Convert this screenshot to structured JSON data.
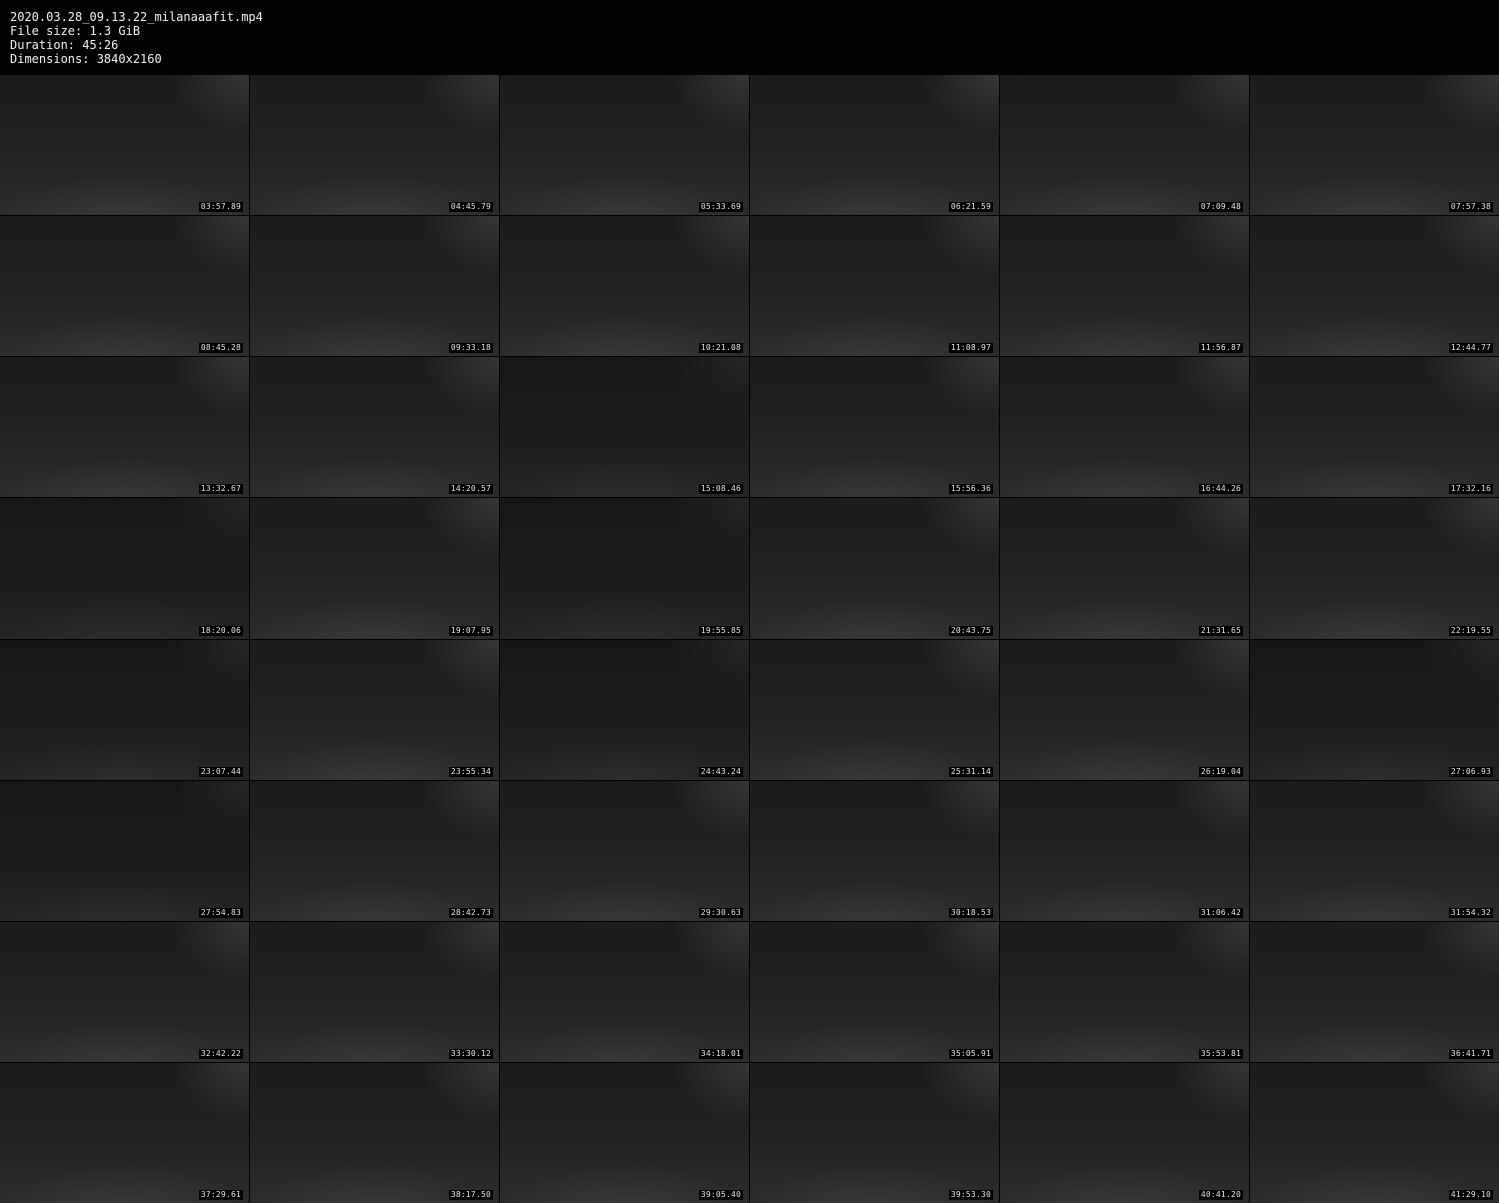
{
  "header": {
    "filename": "2020.03.28_09.13.22_milanaaafit.mp4",
    "file_size": "File size: 1.3 GiB",
    "duration": "Duration: 45:26",
    "dimensions": "Dimensions: 3840x2160"
  },
  "thumbnails": [
    "03:57.89",
    "04:45.79",
    "05:33.69",
    "06:21.59",
    "07:09.48",
    "07:57.38",
    "08:45.28",
    "09:33.18",
    "10:21.08",
    "11:08.97",
    "11:56.87",
    "12:44.77",
    "13:32.67",
    "14:20.57",
    "15:08.46",
    "15:56.36",
    "16:44.26",
    "17:32.16",
    "18:20.06",
    "19:07.95",
    "19:55.85",
    "20:43.75",
    "21:31.65",
    "22:19.55",
    "23:07.44",
    "23:55.34",
    "24:43.24",
    "25:31.14",
    "26:19.04",
    "27:06.93",
    "27:54.83",
    "28:42.73",
    "29:30.63",
    "30:18.53",
    "31:06.42",
    "31:54.32",
    "32:42.22",
    "33:30.12",
    "34:18.01",
    "35:05.91",
    "35:53.81",
    "36:41.71",
    "37:29.61",
    "38:17.50",
    "39:05.40",
    "39:53.30",
    "40:41.20",
    "41:29.10"
  ]
}
